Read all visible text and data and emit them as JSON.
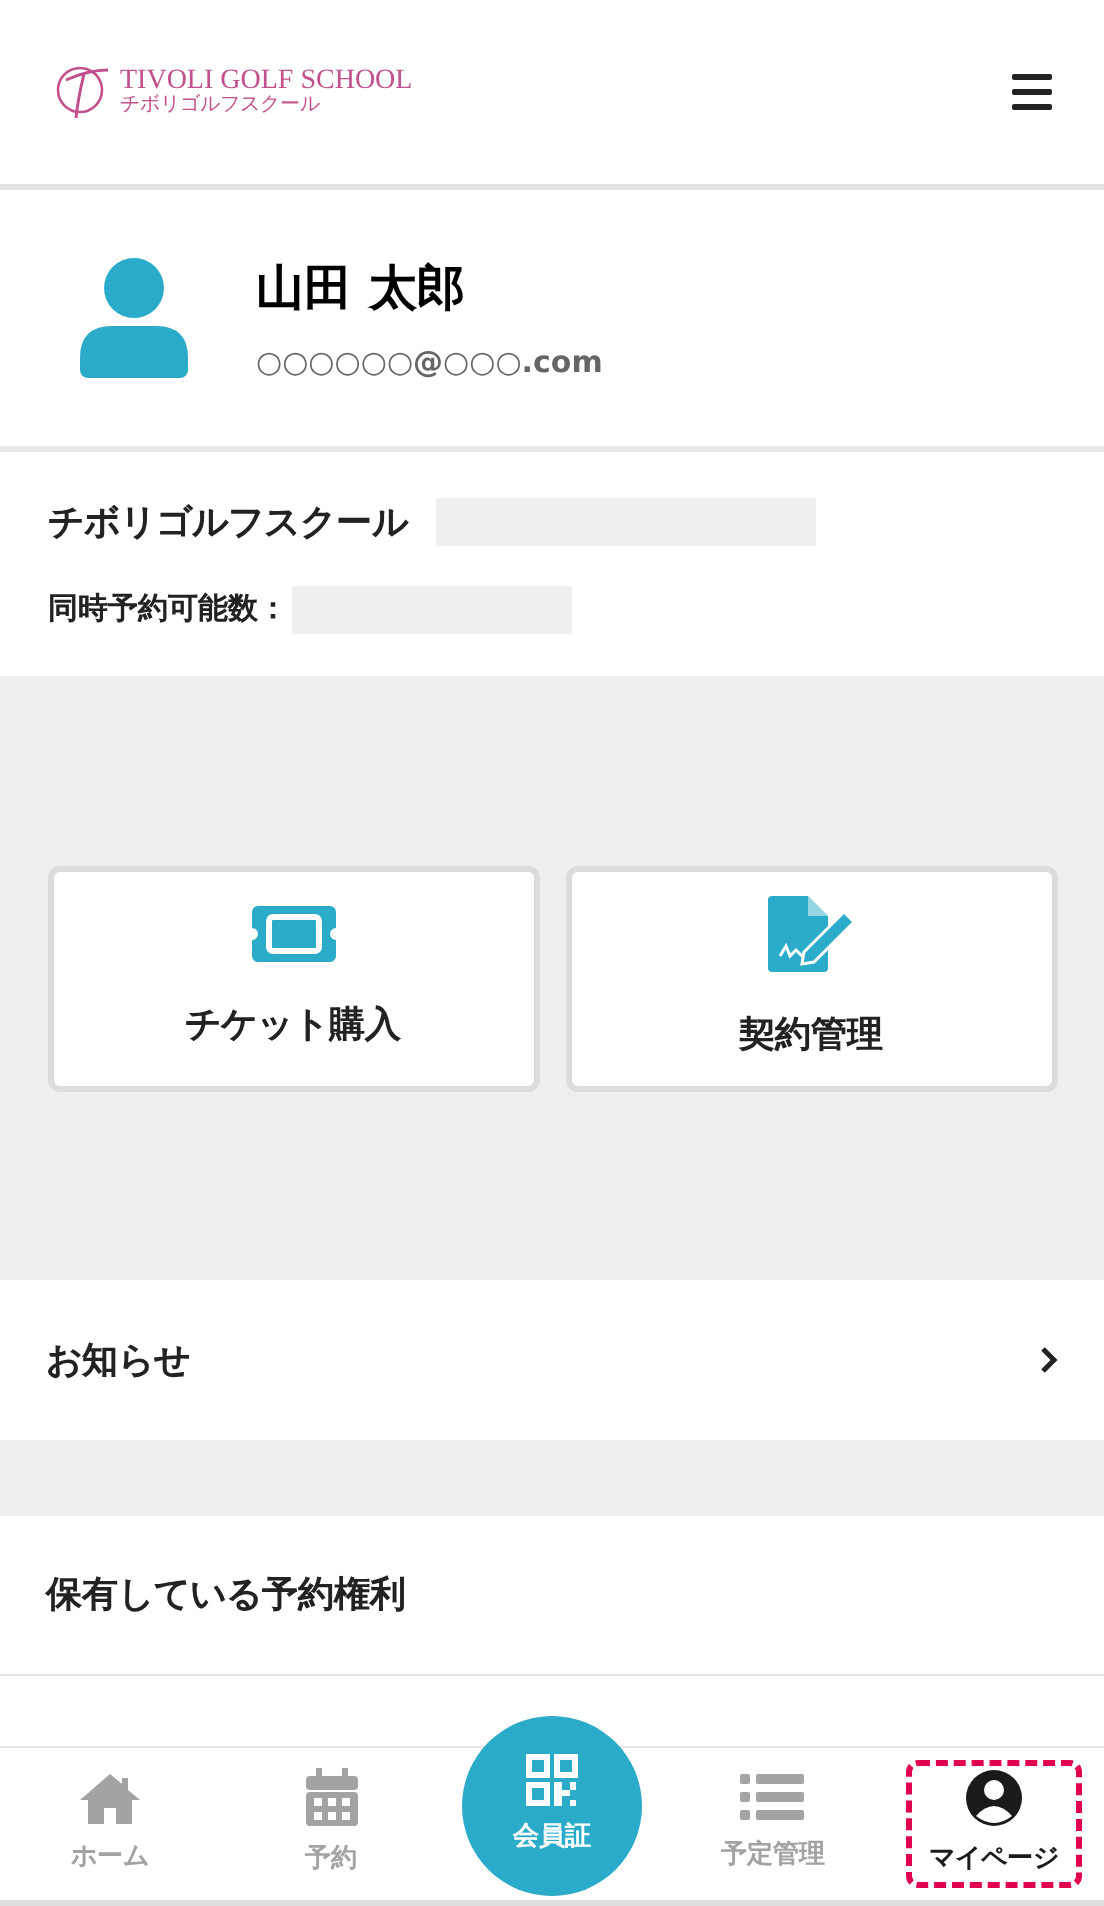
{
  "header": {
    "logo_title": "TIVOLI GOLF SCHOOL",
    "logo_subtitle": "チボリゴルフスクール"
  },
  "profile": {
    "name": "山田 太郎",
    "email": "○○○○○○@○○○.com"
  },
  "school": {
    "name": "チボリゴルフスクール",
    "concurrent_label": "同時予約可能数："
  },
  "actions": [
    {
      "kind": "ticket",
      "label": "チケット購入"
    },
    {
      "kind": "contract",
      "label": "契約管理"
    }
  ],
  "notice": {
    "label": "お知らせ"
  },
  "reservations": {
    "title": "保有している予約権利"
  },
  "nav": [
    {
      "kind": "home",
      "label": "ホーム",
      "selected": false
    },
    {
      "kind": "calendar",
      "label": "予約",
      "selected": false
    },
    {
      "kind": "qr",
      "label": "会員証",
      "selected": false
    },
    {
      "kind": "list",
      "label": "予定管理",
      "selected": false
    },
    {
      "kind": "user",
      "label": "マイページ",
      "selected": true
    }
  ]
}
